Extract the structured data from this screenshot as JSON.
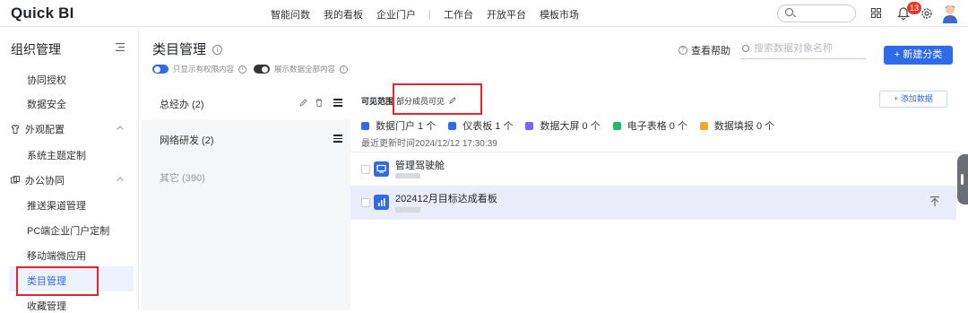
{
  "app": {
    "logo": "Quick BI"
  },
  "topnav": {
    "items": [
      "智能问数",
      "我的看板",
      "企业门户",
      "工作台",
      "开放平台",
      "模板市场"
    ],
    "search_placeholder": "Q",
    "notification_count": "13"
  },
  "sidebar": {
    "title": "组织管理",
    "items_top": [
      "协同授权",
      "数据安全"
    ],
    "group_appearance": "外观配置",
    "items_appearance": [
      "系统主题定制"
    ],
    "group_office": "办公协同",
    "items_office": [
      "推送渠道管理",
      "PC端企业门户定制",
      "移动端微应用",
      "类目管理",
      "收藏管理"
    ],
    "active": "类目管理"
  },
  "main": {
    "title": "类目管理",
    "toggle1_label": "只显示有权限内容",
    "toggle2_label": "展示数据全部内容",
    "help": "查看帮助",
    "search_placeholder": "搜索数据对象名称",
    "new_category": "+ 新建分类"
  },
  "categories": [
    {
      "name": "总经办 (2)"
    },
    {
      "name": "网络研发 (2)"
    },
    {
      "name": "其它 (390)"
    }
  ],
  "detail": {
    "visibility_label": "可见范围",
    "visibility_value": "部分成员可见",
    "add_data": "+ 添加数据",
    "stats": [
      {
        "label": "数据门户 1 个",
        "color": "#2f6ae8"
      },
      {
        "label": "仪表板 1 个",
        "color": "#2f6ae8"
      },
      {
        "label": "数据大屏 0 个",
        "color": "#7b61ff"
      },
      {
        "label": "电子表格 0 个",
        "color": "#28b865"
      },
      {
        "label": "数据填报 0 个",
        "color": "#f5a623"
      }
    ],
    "updated": "最近更新时间2024/12/12 17:30:39",
    "items": [
      {
        "name": "管理驾驶舱"
      },
      {
        "name": "202412月目标达成看板"
      }
    ]
  },
  "colors": {
    "accent": "#2f6ae8",
    "highlight": "#e8232d"
  }
}
